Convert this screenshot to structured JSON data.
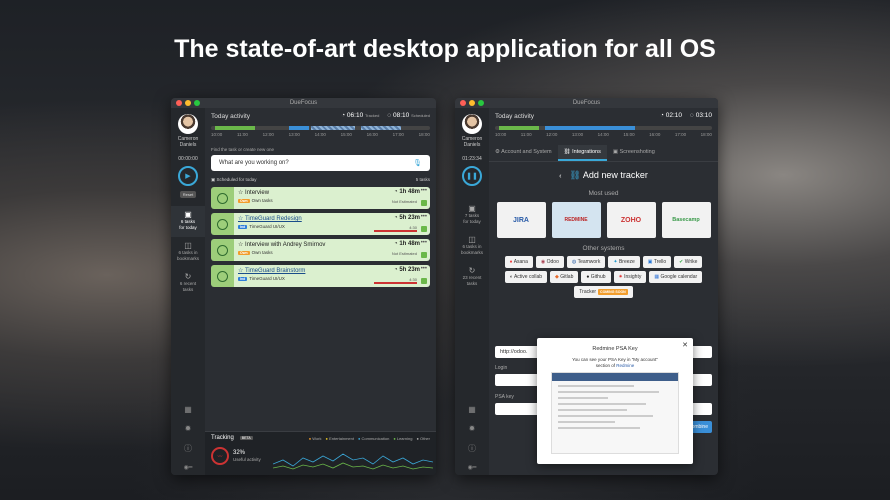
{
  "headline": "The state-of-art desktop application for all OS",
  "app_title": "DueFocus",
  "user": {
    "first": "Cameron",
    "last": "Daniels"
  },
  "w1": {
    "sidebar": {
      "time": "00:00:00",
      "reset": "Reset",
      "nav": [
        {
          "count": "6 tasks",
          "label": "for today"
        },
        {
          "count": "6 tasks in",
          "label": "bookmarks"
        },
        {
          "count": "6 recent",
          "label": "tasks"
        }
      ]
    },
    "today_activity": "Today activity",
    "tracked": "06:10",
    "tracked_label": "Tracked",
    "scheduled": "08:10",
    "scheduled_label": "Scheduled",
    "hours": [
      "10:00",
      "11:00",
      "12:00",
      "13:00",
      "14:00",
      "15:00",
      "16:00",
      "17:00",
      "18:00"
    ],
    "find_label": "Find the task or create new one",
    "search_placeholder": "What are you working on?",
    "sched_label": "Scheduled for today",
    "sched_count": "5 tasks",
    "tasks": [
      {
        "name": "Interview",
        "tag": "Own",
        "project": "Own tasks",
        "time": "1h 48m",
        "note": "Not Estimated"
      },
      {
        "name": "TimeGuard Redesign",
        "tag": "Ind",
        "project": "TimeGuard UI/UX",
        "time": "5h 23m",
        "note": "4:30"
      },
      {
        "name": "Interview with Andrey Smirnov",
        "tag": "Own",
        "project": "Own tasks",
        "time": "1h 48m",
        "note": "Not Estimated"
      },
      {
        "name": "TimeGuard Brainstorm",
        "tag": "Ind",
        "project": "TimeGuard UI/UX",
        "time": "5h 23m",
        "note": "4:30"
      }
    ],
    "tracking": {
      "title": "Tracking",
      "badge": "BETA",
      "pct": "32%",
      "sub": "Useful activity",
      "legend": [
        "Work",
        "Entertainment",
        "Communication",
        "Learning",
        "Other"
      ]
    }
  },
  "w2": {
    "time": "01:23:34",
    "tracked": "02:10",
    "scheduled": "03:10",
    "hours": [
      "10:00",
      "11:00",
      "12:00",
      "13:00",
      "14:00",
      "15:00",
      "16:00",
      "17:00",
      "18:00"
    ],
    "sidebar_nav": [
      {
        "count": "7 tasks",
        "label": "for today"
      },
      {
        "count": "6 tasks in",
        "label": "bookmarks"
      },
      {
        "count": "23 recent",
        "label": "tasks"
      }
    ],
    "tabs": [
      "Account and System",
      "Integrations",
      "Screenshoting"
    ],
    "add_title": "Add new tracker",
    "most_used": "Most used",
    "tiles": [
      "JIRA",
      "REDMINE",
      "ZOHO",
      "Basecamp"
    ],
    "other_systems": "Other systems",
    "systems": [
      "Asana",
      "Odoo",
      "Teamwork",
      "Breeze",
      "Trello",
      "Wrike",
      "Active collab",
      "Gitlab",
      "Github",
      "Insighty",
      "Google calendar",
      "Tracker"
    ],
    "coming_soon": "COMING SOON",
    "url_value": "http://odoo.",
    "login_label": "Login",
    "psa_label": "PSA key",
    "submit": "Combine",
    "modal": {
      "title": "Redmine PSA Key",
      "line1": "You can see your PSA Key in \"My account\"",
      "line2": "section of",
      "link": "Redmine"
    }
  },
  "colors": {
    "accent": "#3aa8d8",
    "task_green": "#dbf0cf",
    "status_green": "#9dce7a"
  }
}
